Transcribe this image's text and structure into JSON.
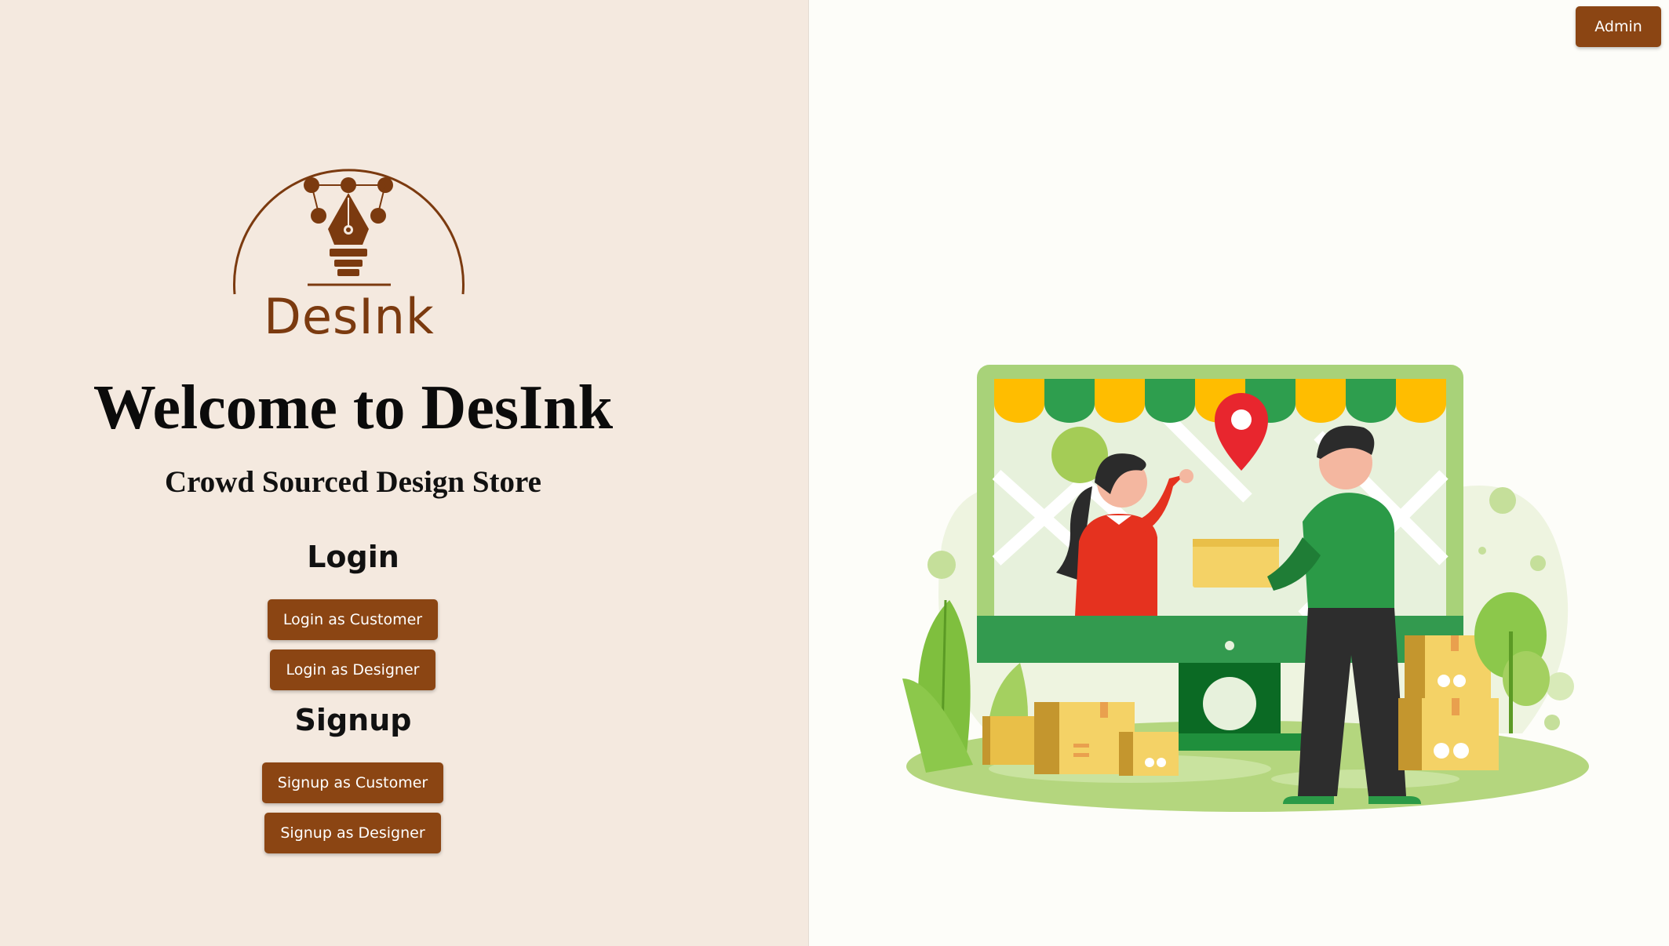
{
  "brand": {
    "logo_text": "DesInk",
    "accent_color": "#8b4513",
    "logo_color": "#7b3a0f"
  },
  "hero": {
    "title": "Welcome to DesInk",
    "subtitle": "Crowd Sourced Design Store"
  },
  "login": {
    "heading": "Login",
    "customer_label": "Login as Customer",
    "designer_label": "Login as Designer"
  },
  "signup": {
    "heading": "Signup",
    "customer_label": "Signup as Customer",
    "designer_label": "Signup as Designer"
  },
  "header": {
    "admin_label": "Admin"
  },
  "illustration": {
    "icon": "online-shop-delivery-illustration"
  }
}
